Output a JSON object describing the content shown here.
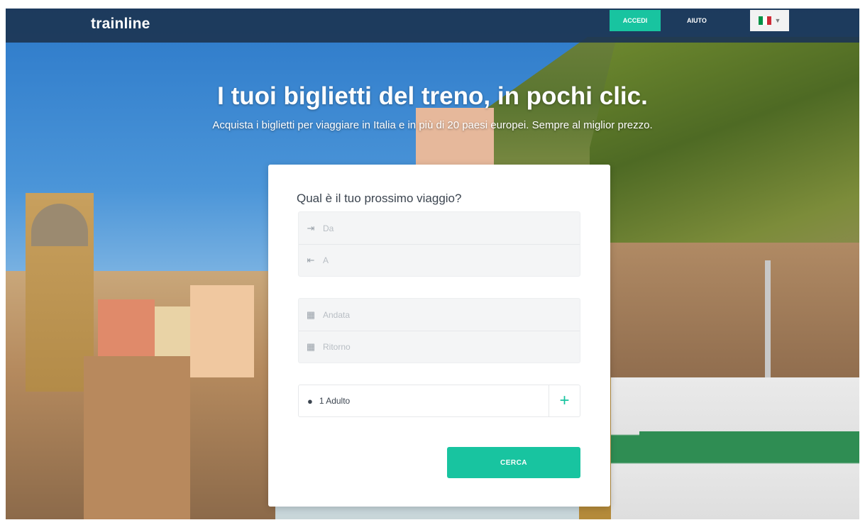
{
  "navbar": {
    "logo": "trainline",
    "login_label": "ACCEDI",
    "help_label": "AIUTO",
    "language": {
      "flag": "italian-flag-icon",
      "colors": [
        "#009246",
        "#ffffff",
        "#ce2b37"
      ]
    }
  },
  "hero": {
    "title": "I tuoi biglietti del treno, in pochi clic.",
    "subtitle": "Acquista i biglietti per viaggiare in Italia e in più di 20 paesi europei. Sempre al miglior prezzo."
  },
  "search": {
    "heading": "Qual è il tuo prossimo viaggio?",
    "from_placeholder": "Da",
    "to_placeholder": "A",
    "departure_placeholder": "Andata",
    "return_placeholder": "Ritorno",
    "passengers": "1 Adulto",
    "add_passenger_symbol": "+",
    "submit_label": "CERCA"
  },
  "colors": {
    "accent": "#18c4a0",
    "navbar": "#1c3554"
  }
}
